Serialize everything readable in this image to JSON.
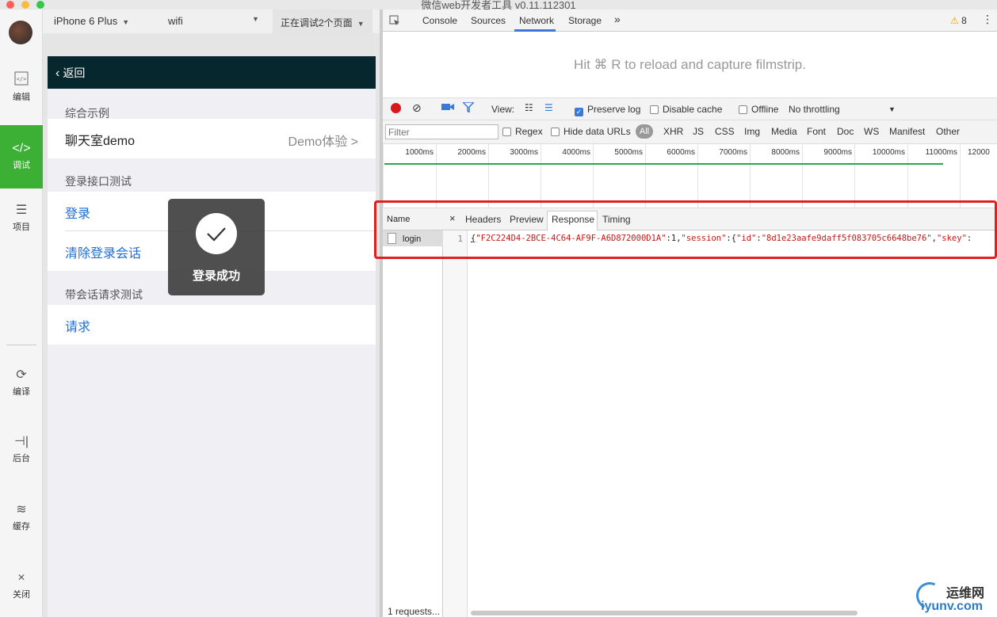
{
  "window": {
    "title": "微信web开发者工具 v0.11.112301"
  },
  "sidebar": {
    "items": [
      {
        "label": "编辑",
        "icon": "code-file-icon"
      },
      {
        "label": "调试",
        "icon": "code-brackets-icon",
        "active": true
      },
      {
        "label": "项目",
        "icon": "menu-lines-icon"
      },
      {
        "label": "编译",
        "icon": "compile-icon"
      },
      {
        "label": "后台",
        "icon": "background-icon"
      },
      {
        "label": "缓存",
        "icon": "layers-icon"
      },
      {
        "label": "关闭",
        "icon": "close-icon"
      }
    ]
  },
  "simulator": {
    "device": "iPhone 6 Plus",
    "network": "wifi",
    "debug_status": "正在调试2个页面",
    "nav": {
      "back_label": "返回"
    },
    "sections": [
      {
        "header": "综合示例",
        "rows": [
          {
            "label": "聊天室demo",
            "right": "Demo体验 >"
          }
        ]
      },
      {
        "header": "登录接口测试",
        "rows": [
          {
            "label": "登录"
          },
          {
            "label": "清除登录会话"
          }
        ]
      },
      {
        "header": "带会话请求测试",
        "rows": [
          {
            "label": "请求"
          }
        ]
      }
    ],
    "toast": {
      "text": "登录成功",
      "icon": "checkmark-icon"
    }
  },
  "devtools": {
    "tabs": [
      "Console",
      "Sources",
      "Network",
      "Storage",
      "»"
    ],
    "active_tab": "Network",
    "warning_count": "8",
    "filmstrip_message": "Hit ⌘ R to reload and capture filmstrip.",
    "toolbar": {
      "view_label": "View:",
      "preserve_log": "Preserve log",
      "disable_cache": "Disable cache",
      "offline": "Offline",
      "throttling": "No throttling"
    },
    "filter": {
      "placeholder": "Filter",
      "regex": "Regex",
      "hide_data_urls": "Hide data URLs",
      "types": [
        "All",
        "XHR",
        "JS",
        "CSS",
        "Img",
        "Media",
        "Font",
        "Doc",
        "WS",
        "Manifest",
        "Other"
      ]
    },
    "timeline_ticks": [
      "1000ms",
      "2000ms",
      "3000ms",
      "4000ms",
      "5000ms",
      "6000ms",
      "7000ms",
      "8000ms",
      "9000ms",
      "10000ms",
      "11000ms",
      "12000"
    ],
    "requests": {
      "name_header": "Name",
      "rows": [
        "login"
      ],
      "count_label": "1 requests..."
    },
    "detail": {
      "close": "×",
      "tabs": [
        "Headers",
        "Preview",
        "Response",
        "Timing"
      ],
      "active_tab": "Response",
      "line_number": "1",
      "response_text": {
        "p1": "{",
        "s1": "\"F2C224D4-2BCE-4C64-AF9F-A6D872000D1A\"",
        "p2": ":1,",
        "s2": "\"session\"",
        "p3": ":{",
        "s3": "\"id\"",
        "p4": ":",
        "s4": "\"8d1e23aafe9daff5f083705c6648be76\"",
        "p5": ",",
        "s5": "\"skey\"",
        "p6": ":"
      }
    }
  },
  "watermark": {
    "cn": "运维网",
    "url": "iyunv.com"
  },
  "colors": {
    "accent_green": "#3cb034",
    "nav_dark": "#07272e",
    "link_blue": "#1f6dd6",
    "highlight_red": "#e0201f"
  }
}
